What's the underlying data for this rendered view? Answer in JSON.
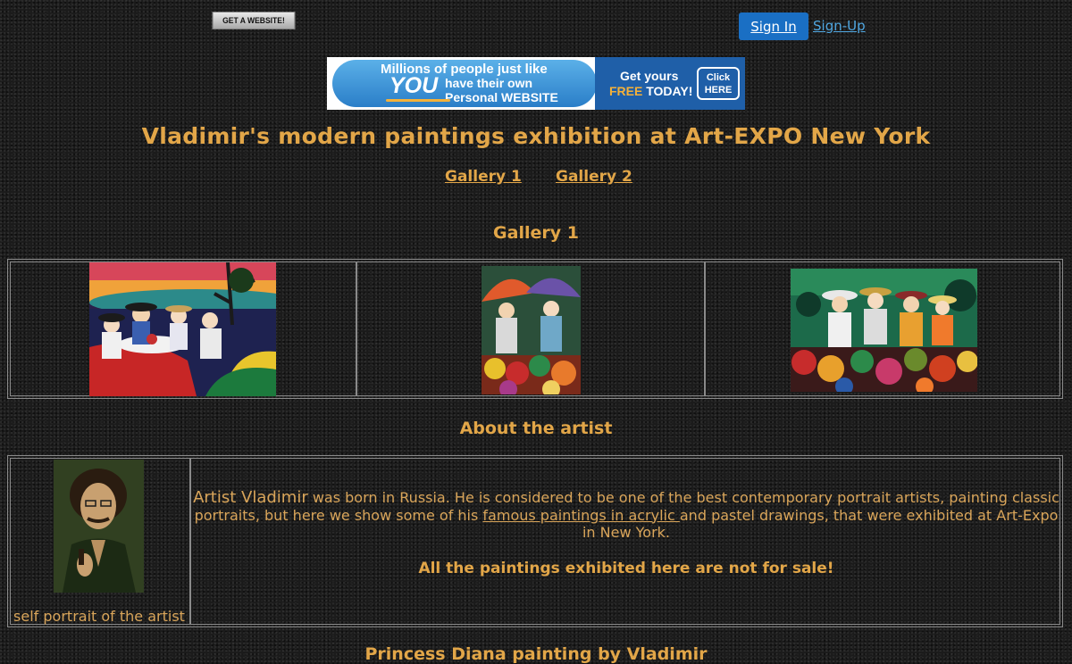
{
  "header": {
    "get_website_label": "GET A WEBSITE!",
    "sign_in_label": "Sign In",
    "sign_up_label": "Sign-Up"
  },
  "banner": {
    "line1": "Millions of people just like",
    "you": "YOU",
    "line2a": "have their own",
    "line2b": "Personal WEBSITE",
    "get_yours": "Get yours",
    "free": "FREE",
    "today": "TODAY!",
    "click1": "Click",
    "click2": "HERE"
  },
  "page": {
    "title": "Vladimir's modern paintings exhibition at  Art-EXPO New York",
    "nav": [
      "Gallery 1",
      "Gallery 2"
    ],
    "gallery_heading": "Gallery 1",
    "about_heading": "About the artist",
    "about": {
      "lead": "Artist Vladimir",
      "text1": " was born in Russia. He is considered to be one of the best contemporary  portrait artists, painting classic portraits, but here we show some of his ",
      "link": "famous paintings in acrylic ",
      "text2": "and  pastel drawings, that were exhibited at Art-Expo in New York."
    },
    "not_for_sale": "All the paintings exhibited here are not for sale!",
    "portrait_caption": "self portrait of the artist",
    "next_heading": "Princess Diana painting by Vladimir"
  },
  "colors": {
    "gold_text": "#e2a648",
    "sign_in_bg": "#1a6fc4",
    "sign_up_link": "#4fa6e0",
    "background": "#1b1b1b"
  }
}
